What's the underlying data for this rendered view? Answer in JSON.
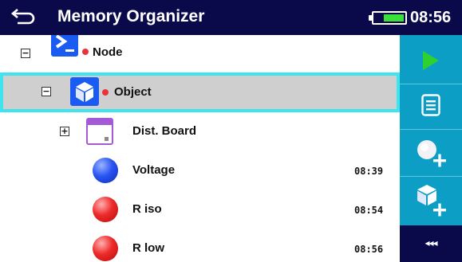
{
  "header": {
    "title": "Memory Organizer",
    "time": "08:56",
    "battery_level": 0.7,
    "back_icon": "back-arrow-icon"
  },
  "tree": [
    {
      "label": "Node",
      "toggle": "−",
      "icon": "node-terminal-icon",
      "selected": false
    },
    {
      "label": "Object",
      "toggle": "−",
      "icon": "object-cube-icon",
      "selected": true
    },
    {
      "label": "Dist. Board",
      "toggle": "+",
      "icon": "distribution-board-icon",
      "selected": false
    },
    {
      "label": "Voltage",
      "time": "08:39",
      "icon": "blue-test-ball-icon",
      "status_color": "#1a3fd6"
    },
    {
      "label": "R iso",
      "time": "08:54",
      "icon": "red-test-ball-icon",
      "status_color": "#e21a1a"
    },
    {
      "label": "R low",
      "time": "08:56",
      "icon": "red-test-ball-icon",
      "status_color": "#e21a1a"
    }
  ],
  "sidebar": {
    "collapse_label": "◂◂◂",
    "buttons": [
      "start-test-icon",
      "list-details-icon",
      "add-measurement-icon",
      "add-structure-icon"
    ]
  },
  "colors": {
    "titlebar": "#0a0a4a",
    "sidebar": "#0c9ec4",
    "selection_border": "#40e4ee",
    "selection_fill": "#cfcfcf",
    "accent_green": "#2ed12e",
    "marker_red": "#e8323c"
  }
}
